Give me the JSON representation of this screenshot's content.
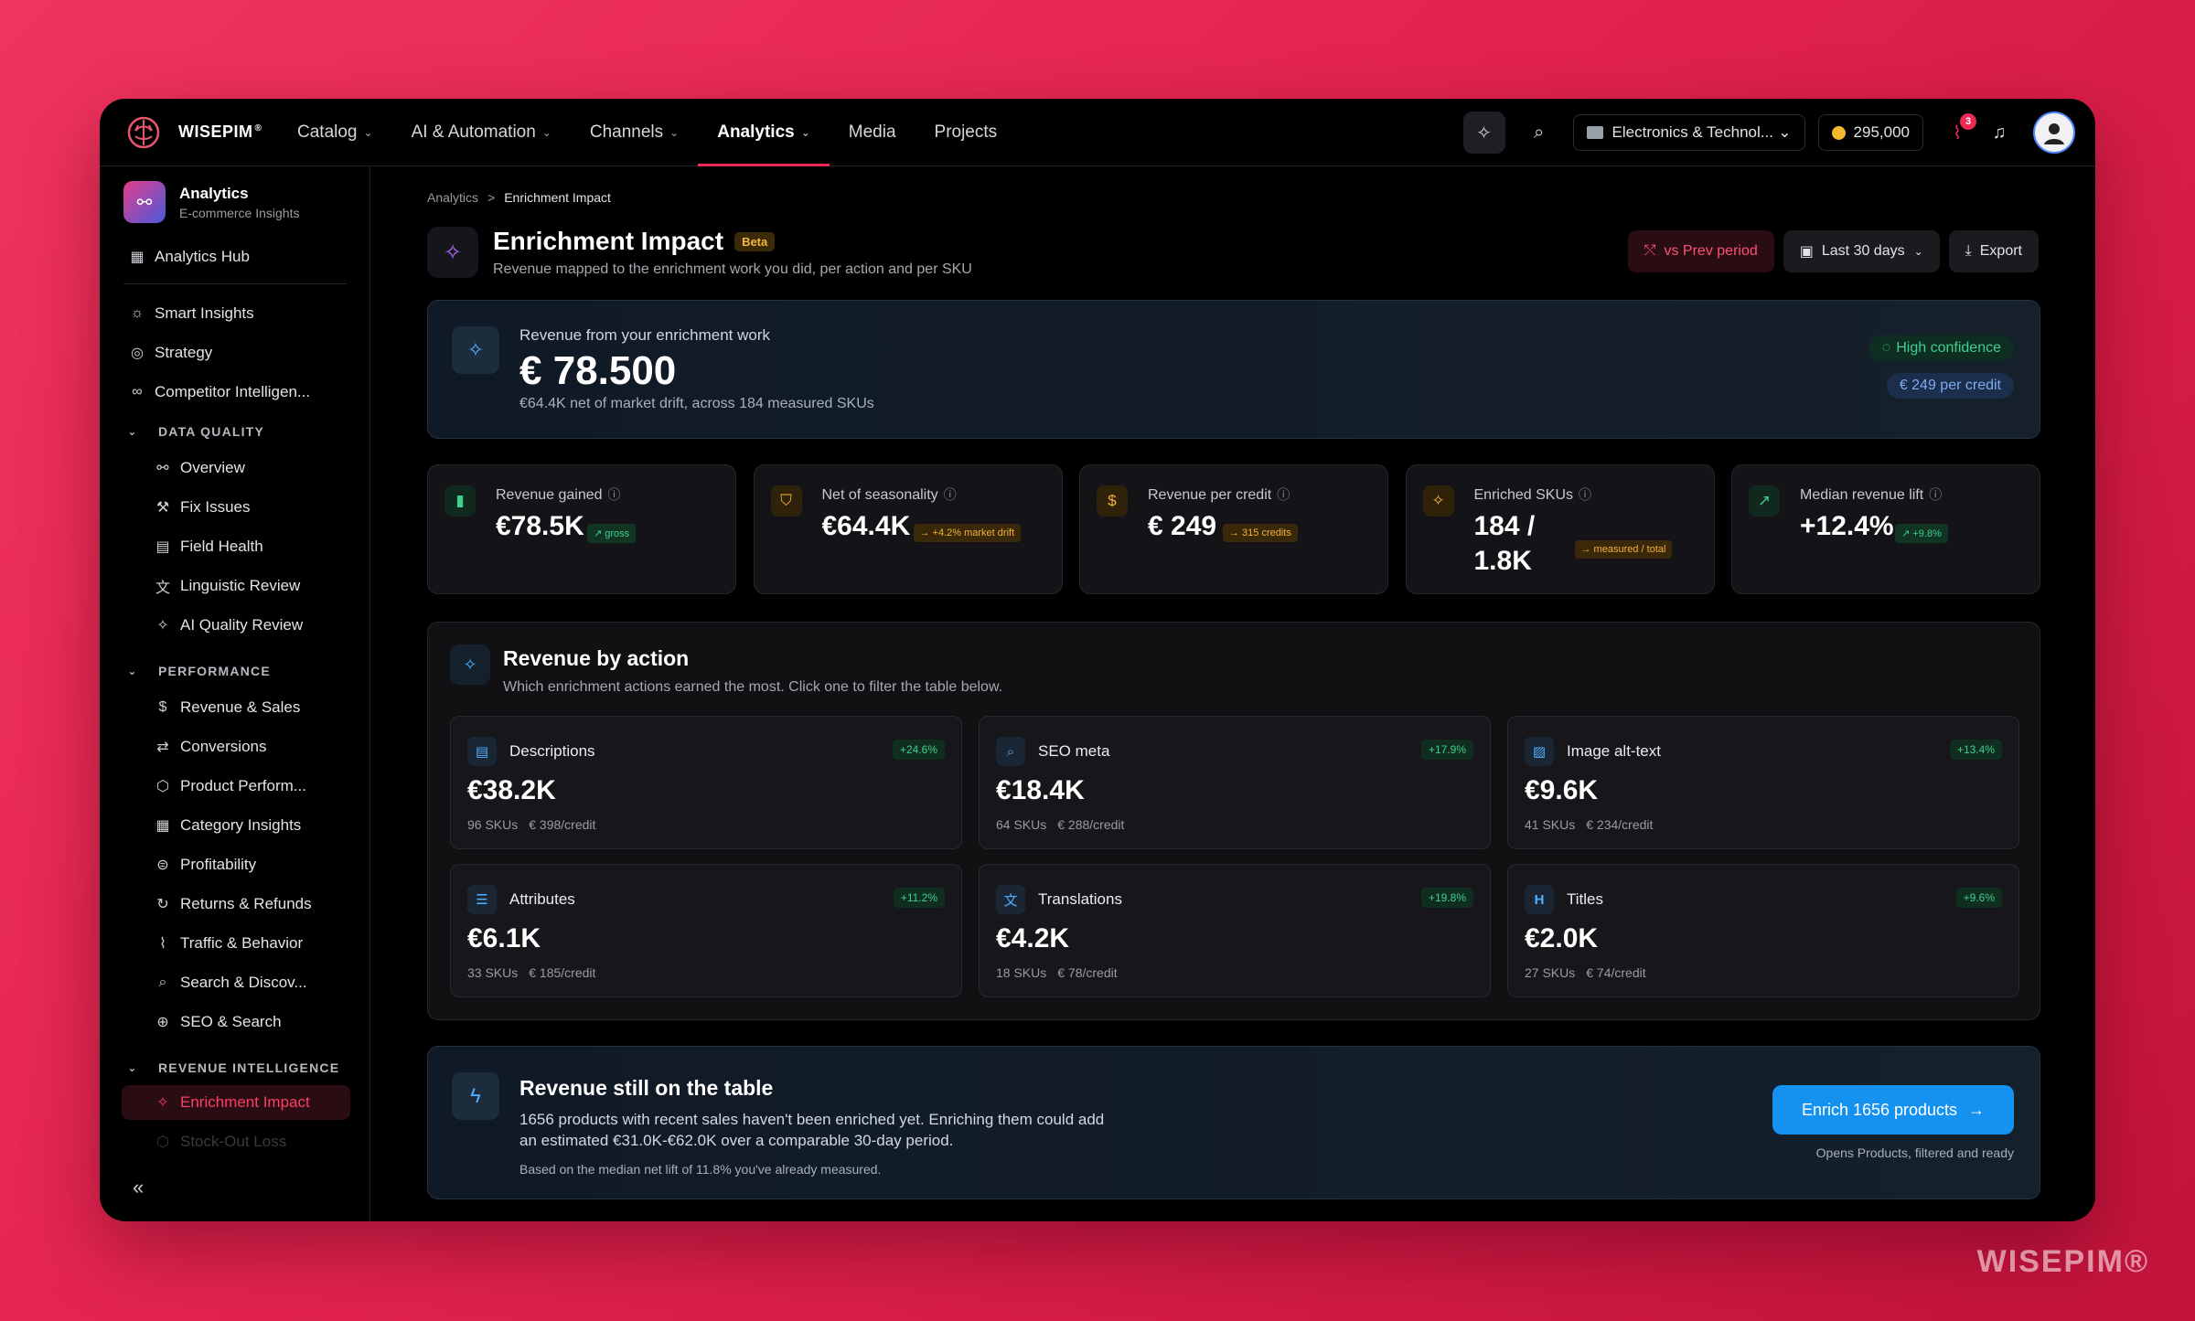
{
  "brand": {
    "name": "WISEPIM",
    "mark": "®",
    "watermark": "WISEPIM®"
  },
  "nav": [
    {
      "label": "Catalog",
      "has_menu": true
    },
    {
      "label": "AI & Automation",
      "has_menu": true
    },
    {
      "label": "Channels",
      "has_menu": true
    },
    {
      "label": "Analytics",
      "has_menu": true,
      "active": true
    },
    {
      "label": "Media",
      "has_menu": false
    },
    {
      "label": "Projects",
      "has_menu": false
    }
  ],
  "topbar": {
    "workspace": "Electronics & Technol...",
    "credits": "295,000",
    "alerts_count": "3",
    "icons": [
      "sparkle-icon",
      "search-icon",
      "folder-icon",
      "coin-icon",
      "pulse-icon",
      "bell-icon",
      "user-icon"
    ]
  },
  "sidebar": {
    "app": {
      "title": "Analytics",
      "subtitle": "E-commerce Insights"
    },
    "hub": "Analytics Hub",
    "top_items": [
      "Smart Insights",
      "Strategy",
      "Competitor Intelligen..."
    ],
    "sections": [
      {
        "title": "DATA QUALITY",
        "items": [
          "Overview",
          "Fix Issues",
          "Field Health",
          "Linguistic Review",
          "AI Quality Review"
        ]
      },
      {
        "title": "PERFORMANCE",
        "items": [
          "Revenue & Sales",
          "Conversions",
          "Product Perform...",
          "Category Insights",
          "Profitability",
          "Returns & Refunds",
          "Traffic & Behavior",
          "Search & Discov...",
          "SEO & Search"
        ]
      },
      {
        "title": "REVENUE INTELLIGENCE",
        "items": [
          "Enrichment Impact",
          "Stock-Out Loss"
        ]
      }
    ],
    "active_item": "Enrichment Impact",
    "collapse_label": "«"
  },
  "breadcrumb": {
    "parent": "Analytics",
    "sep": ">",
    "current": "Enrichment Impact"
  },
  "page": {
    "title": "Enrichment Impact",
    "badge": "Beta",
    "subtitle": "Revenue mapped to the enrichment work you did, per action and per SKU",
    "actions": {
      "compare": "vs Prev period",
      "range": "Last 30 days",
      "export": "Export"
    }
  },
  "hero": {
    "label": "Revenue from your enrichment work",
    "value": "€ 78.500",
    "note": "€64.4K net of market drift, across 184 measured SKUs",
    "confidence": "High confidence",
    "per_credit": "€ 249 per credit"
  },
  "kpis": [
    {
      "label": "Revenue gained",
      "value": "€78.5K",
      "pill": "↗ gross",
      "tone": "green",
      "icon": "bar-chart-icon",
      "color": "#3fcf8e"
    },
    {
      "label": "Net of seasonality",
      "value": "€64.4K",
      "pill": "→ +4.2% market drift",
      "tone": "amber",
      "icon": "shield-icon",
      "color": "#f3b13d"
    },
    {
      "label": "Revenue per credit",
      "value": "€ 249",
      "pill": "→ 315 credits",
      "tone": "amber",
      "icon": "dollar-icon",
      "color": "#f3b13d"
    },
    {
      "label": "Enriched SKUs",
      "value": "184 / 1.8K",
      "pill": "→ measured / total",
      "tone": "amber",
      "icon": "sparkle-icon",
      "color": "#f3b13d"
    },
    {
      "label": "Median revenue lift",
      "value": "+12.4%",
      "pill": "↗ +9.8%",
      "tone": "green",
      "icon": "trend-up-icon",
      "color": "#3fcf8e"
    }
  ],
  "revenue_by_action": {
    "title": "Revenue by action",
    "subtitle": "Which enrichment actions earned the most. Click one to filter the table below.",
    "cards": [
      {
        "name": "Descriptions",
        "change": "+24.6%",
        "value": "€38.2K",
        "skus": "96 SKUs",
        "per_credit": "€ 398/credit",
        "icon": "document-icon"
      },
      {
        "name": "SEO meta",
        "change": "+17.9%",
        "value": "€18.4K",
        "skus": "64 SKUs",
        "per_credit": "€ 288/credit",
        "icon": "search-icon"
      },
      {
        "name": "Image alt-text",
        "change": "+13.4%",
        "value": "€9.6K",
        "skus": "41 SKUs",
        "per_credit": "€ 234/credit",
        "icon": "image-icon"
      },
      {
        "name": "Attributes",
        "change": "+11.2%",
        "value": "€6.1K",
        "skus": "33 SKUs",
        "per_credit": "€ 185/credit",
        "icon": "list-icon"
      },
      {
        "name": "Translations",
        "change": "+19.8%",
        "value": "€4.2K",
        "skus": "18 SKUs",
        "per_credit": "€ 78/credit",
        "icon": "translate-icon"
      },
      {
        "name": "Titles",
        "change": "+9.6%",
        "value": "€2.0K",
        "skus": "27 SKUs",
        "per_credit": "€ 74/credit",
        "icon": "heading-icon"
      }
    ]
  },
  "opportunity": {
    "title": "Revenue still on the table",
    "text": "1656 products with recent sales haven't been enriched yet. Enriching them could add an estimated €31.0K-€62.0K over a comparable 30-day period.",
    "footnote": "Based on the median net lift of 11.8% you've already measured.",
    "button": "Enrich 1656 products",
    "button_note": "Opens Products, filtered and ready"
  }
}
